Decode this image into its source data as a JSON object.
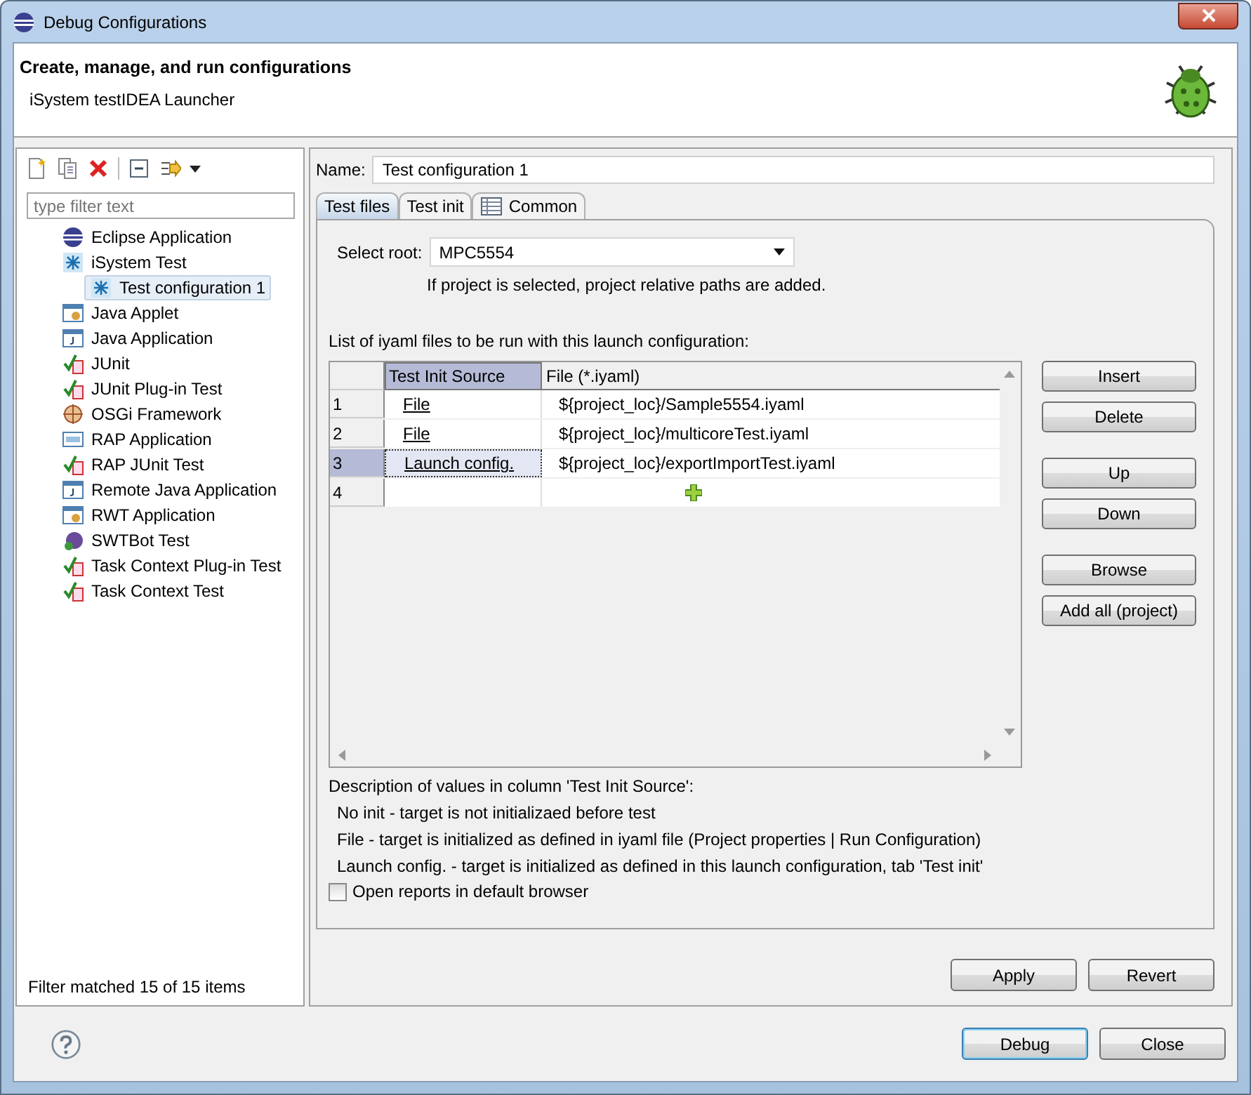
{
  "window": {
    "title": "Debug Configurations"
  },
  "header": {
    "title": "Create, manage, and run configurations",
    "subtitle": "iSystem testIDEA Launcher"
  },
  "sidebar": {
    "filter": {
      "placeholder": "type filter text"
    },
    "items": [
      {
        "label": "Eclipse Application",
        "selected": false
      },
      {
        "label": "iSystem Test",
        "selected": false,
        "expanded": true,
        "children": [
          {
            "label": "Test configuration 1",
            "selected": true
          }
        ]
      },
      {
        "label": "Java Applet",
        "selected": false
      },
      {
        "label": "Java Application",
        "selected": false
      },
      {
        "label": "JUnit",
        "selected": false
      },
      {
        "label": "JUnit Plug-in Test",
        "selected": false
      },
      {
        "label": "OSGi Framework",
        "selected": false
      },
      {
        "label": "RAP Application",
        "selected": false
      },
      {
        "label": "RAP JUnit Test",
        "selected": false
      },
      {
        "label": "Remote Java Application",
        "selected": false
      },
      {
        "label": "RWT Application",
        "selected": false
      },
      {
        "label": "SWTBot Test",
        "selected": false
      },
      {
        "label": "Task Context Plug-in Test",
        "selected": false
      },
      {
        "label": "Task Context Test",
        "selected": false
      }
    ],
    "status": "Filter matched 15 of 15 items"
  },
  "name_field": {
    "label": "Name:",
    "value": "Test configuration 1"
  },
  "tabs": [
    {
      "label": "Test files",
      "selected": true
    },
    {
      "label": "Test init",
      "selected": false
    },
    {
      "label": "Common",
      "selected": false
    }
  ],
  "root_select": {
    "label": "Select root:",
    "value": "MPC5554",
    "hint": "If project is selected, project relative paths are added."
  },
  "list_label": "List of iyaml files to be run with this launch configuration:",
  "table": {
    "columns": [
      "Test Init Source",
      "File (*.iyaml)"
    ],
    "rows": [
      {
        "kind": "file",
        "number": "1",
        "source": "File",
        "file": "${project_loc}/Sample5554.iyaml",
        "selected": false
      },
      {
        "kind": "file",
        "number": "2",
        "source": "File",
        "file": "${project_loc}/multicoreTest.iyaml",
        "selected": false
      },
      {
        "kind": "file",
        "number": "3",
        "source": "Launch config.",
        "file": "${project_loc}/exportImportTest.iyaml",
        "selected": true
      },
      {
        "kind": "add",
        "number": "4",
        "selected": false
      }
    ]
  },
  "side_buttons": [
    [
      "Insert",
      "Delete"
    ],
    [
      "Up",
      "Down"
    ],
    [
      "Browse",
      "Add all (project)"
    ]
  ],
  "description": {
    "title": "Description of values in column 'Test Init Source':",
    "lines": [
      "No init - target is not initializaed before test",
      "File - target is initialized as defined in iyaml file (Project properties | Run Configuration)",
      "Launch config. - target is initialized as defined in this launch configuration, tab 'Test init'"
    ]
  },
  "open_reports": {
    "label": "Open reports in default browser",
    "checked": false
  },
  "panel_buttons": [
    "Apply",
    "Revert"
  ],
  "dialog_buttons": [
    {
      "label": "Debug",
      "default": true
    },
    {
      "label": "Close",
      "default": false
    }
  ]
}
